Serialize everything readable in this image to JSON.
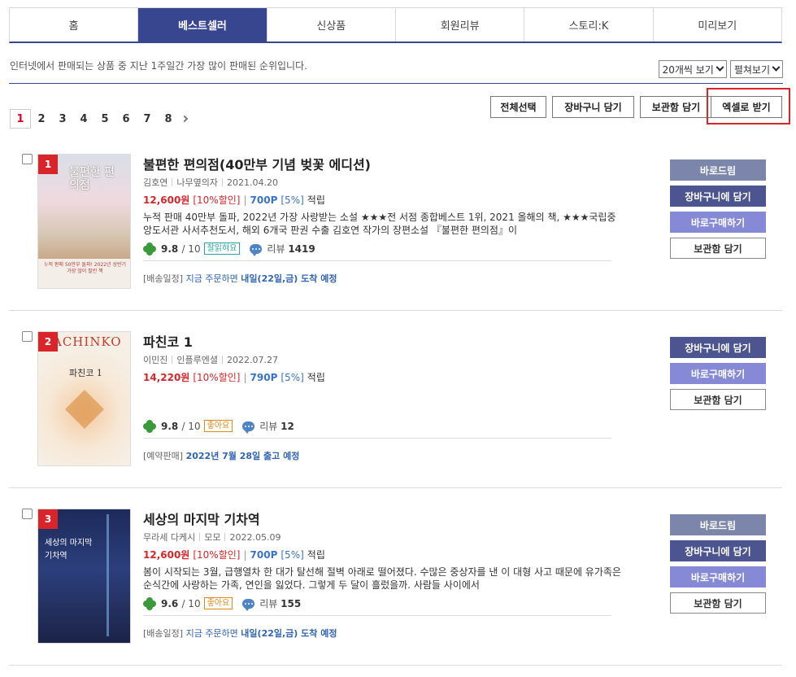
{
  "tabs": [
    {
      "label": "홈"
    },
    {
      "label": "베스트셀러"
    },
    {
      "label": "신상품"
    },
    {
      "label": "회원리뷰"
    },
    {
      "label": "스토리:K"
    },
    {
      "label": "미리보기"
    }
  ],
  "active_tab": "베스트셀러",
  "info_text": "인터넷에서 판매되는 상품 중 지난 1주일간 가장 많이 판매된 순위입니다.",
  "view_count": "20개씩 보기",
  "view_mode": "펼쳐보기",
  "pagination": {
    "current": "1",
    "pages": [
      "1",
      "2",
      "3",
      "4",
      "5",
      "6",
      "7",
      "8"
    ]
  },
  "actions": {
    "select_all": "전체선택",
    "add_cart": "장바구니 담기",
    "add_wishlist": "보관함 담기",
    "excel": "엑셀로 받기"
  },
  "items": [
    {
      "rank": "1",
      "title": "불편한 편의점(40만부 기념 벚꽃 에디션)",
      "author": "김호연",
      "publisher": "나무옆의자",
      "date": "2021.04.20",
      "price": "12,600원",
      "discount": "[10%할인]",
      "points": "700P",
      "points_pct": "[5%]",
      "accrual": "적립",
      "description": "누적 판매 40만부 돌파, 2022년 가장 사랑받는 소설 ★★★전 서점 종합베스트 1위, 2021 올해의 책, ★★★국립중앙도서관 사서추천도서, 해외 6개국 판권 수출 김호연 작가의 장편소설 『불편한 편의점』이",
      "score": "9.8",
      "score_of": "/ 10",
      "badge": "잘읽혀요",
      "review_label": "리뷰",
      "review_count": "1419",
      "ship_label": "[배송일정]",
      "ship_text": "지금 주문하면",
      "ship_bold": "내일(22일,금) 도착 예정",
      "cover_text": "불편한 편의점",
      "cover_sub": "누적 판매 50만부 돌파! 2022년 상반기 가장 많이 팔린 책",
      "buttons": [
        "바로드림",
        "장바구니에 담기",
        "바로구매하기",
        "보관함 담기"
      ]
    },
    {
      "rank": "2",
      "title": "파친코 1",
      "author": "이민진",
      "publisher": "인플루엔셜",
      "date": "2022.07.27",
      "price": "14,220원",
      "discount": "[10%할인]",
      "points": "790P",
      "points_pct": "[5%]",
      "accrual": "적립",
      "description": "",
      "score": "9.8",
      "score_of": "/ 10",
      "badge": "좋아요",
      "review_label": "리뷰",
      "review_count": "12",
      "ship_label": "[예약판매]",
      "ship_text": "",
      "ship_bold": "2022년 7월 28일 출고 예정",
      "cover_text": "ACHINKO",
      "cover_sub": "파친코 1",
      "buttons": [
        "장바구니에 담기",
        "바로구매하기",
        "보관함 담기"
      ]
    },
    {
      "rank": "3",
      "title": "세상의 마지막 기차역",
      "author": "무라세 다케시",
      "publisher": "모모",
      "date": "2022.05.09",
      "price": "12,600원",
      "discount": "[10%할인]",
      "points": "700P",
      "points_pct": "[5%]",
      "accrual": "적립",
      "description": "봄이 시작되는 3월, 급행열차 한 대가 탈선해 절벽 아래로 떨어졌다. 수많은 중상자를 낸 이 대형 사고 때문에 유가족은 순식간에 사랑하는 가족, 연인을 잃었다. 그렇게 두 달이 흘렀을까. 사람들 사이에서",
      "score": "9.6",
      "score_of": "/ 10",
      "badge": "좋아요",
      "review_label": "리뷰",
      "review_count": "155",
      "ship_label": "[배송일정]",
      "ship_text": "지금 주문하면",
      "ship_bold": "내일(22일,금) 도착 예정",
      "cover_text": "세상의 마지막 기차역",
      "cover_sub": "",
      "buttons": [
        "바로드림",
        "장바구니에 담기",
        "바로구매하기",
        "보관함 담기"
      ]
    }
  ],
  "colors": {
    "navy": "#38458f",
    "red": "#d9252a",
    "blue": "#3873c8"
  }
}
